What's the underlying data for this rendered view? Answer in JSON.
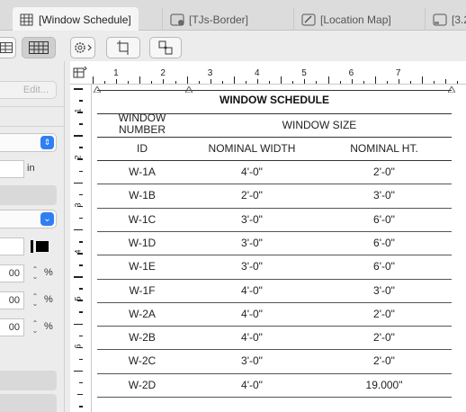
{
  "tabs": [
    {
      "label": "[Window Schedule]",
      "active": true,
      "icon": "table-icon"
    },
    {
      "label": "[TJs-Border]",
      "active": false,
      "icon": "layout-icon"
    },
    {
      "label": "[Location Map]",
      "active": false,
      "icon": "drawing-icon"
    },
    {
      "label": "[3.2",
      "active": false,
      "icon": "layout-icon"
    }
  ],
  "left_panel": {
    "edit_label": "Edit...",
    "unit_in": "in",
    "field_a": "00",
    "field_b": "00",
    "field_c": "00",
    "unit_pct": "%"
  },
  "ruler": {
    "top_labels": [
      "1",
      "2",
      "3",
      "4",
      "5",
      "6",
      "7"
    ],
    "left_labels": [
      "1",
      "2",
      "3",
      "4",
      "5",
      "6"
    ]
  },
  "schedule": {
    "title": "WINDOW SCHEDULE",
    "col1_header_line1": "WINDOW",
    "col1_header_line2": "NUMBER",
    "group_header": "WINDOW SIZE",
    "sub_headers": [
      "ID",
      "NOMINAL WIDTH",
      "NOMINAL HT."
    ],
    "rows": [
      {
        "id": "W-1A",
        "width": "4'-0\"",
        "height": "2'-0\""
      },
      {
        "id": "W-1B",
        "width": "2'-0\"",
        "height": "3'-0\""
      },
      {
        "id": "W-1C",
        "width": "3'-0\"",
        "height": "6'-0\""
      },
      {
        "id": "W-1D",
        "width": "3'-0\"",
        "height": "6'-0\""
      },
      {
        "id": "W-1E",
        "width": "3'-0\"",
        "height": "6'-0\""
      },
      {
        "id": "W-1F",
        "width": "4'-0\"",
        "height": "3'-0\""
      },
      {
        "id": "W-2A",
        "width": "4'-0\"",
        "height": "2'-0\""
      },
      {
        "id": "W-2B",
        "width": "4'-0\"",
        "height": "2'-0\""
      },
      {
        "id": "W-2C",
        "width": "3'-0\"",
        "height": "2'-0\""
      },
      {
        "id": "W-2D",
        "width": "4'-0\"",
        "height": "19.000\""
      }
    ]
  },
  "colors": {
    "accent": "#2f7ff3",
    "canvas": "#ffffff",
    "chrome": "#ececec"
  }
}
